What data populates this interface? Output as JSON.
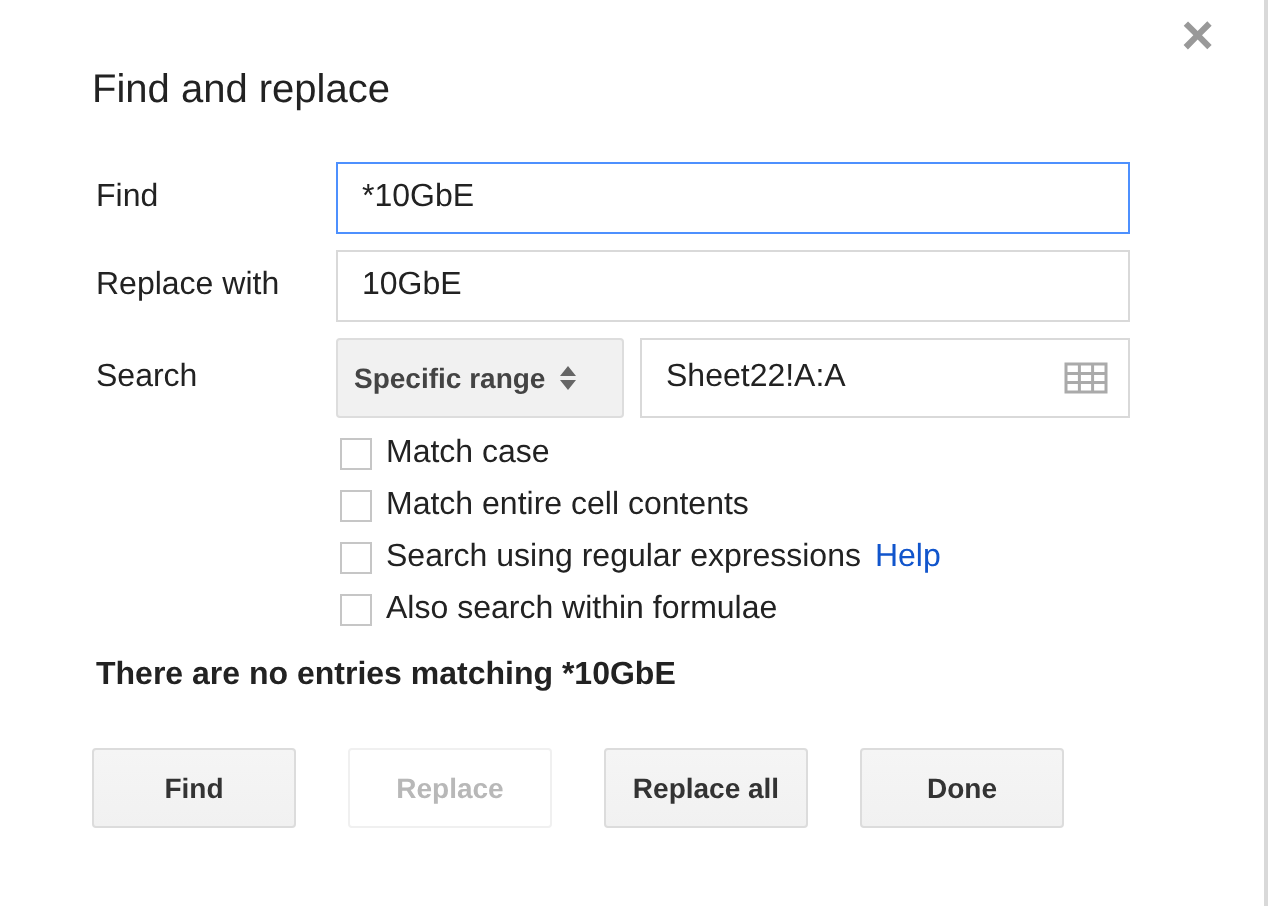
{
  "dialog": {
    "title": "Find and replace",
    "close": "×"
  },
  "fields": [
    {
      "label": "Find",
      "value": "*10GbE",
      "focused": true
    },
    {
      "label": "Replace with",
      "value": "10GbE",
      "focused": false
    }
  ],
  "search": {
    "label": "Search",
    "scope": "Specific range",
    "range": "Sheet22!A:A"
  },
  "options": [
    {
      "label": "Match case",
      "checked": false
    },
    {
      "label": "Match entire cell contents",
      "checked": false
    },
    {
      "label": "Search using regular expressions",
      "checked": false,
      "link": "Help"
    },
    {
      "label": "Also search within formulae",
      "checked": false
    }
  ],
  "message": "There are no entries matching *10GbE",
  "buttons": [
    {
      "label": "Find",
      "disabled": false
    },
    {
      "label": "Replace",
      "disabled": true
    },
    {
      "label": "Replace all",
      "disabled": false
    },
    {
      "label": "Done",
      "disabled": false
    }
  ]
}
